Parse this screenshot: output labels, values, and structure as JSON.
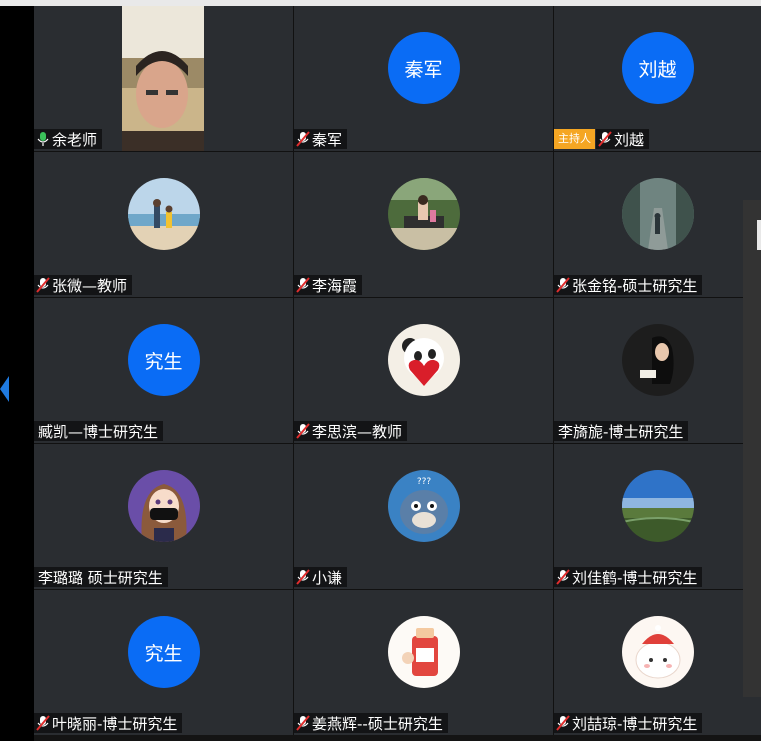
{
  "colors": {
    "accent_blue": "#0a6cf5",
    "host_badge": "#f5a623",
    "tile_bg": "#2a2d31",
    "mic_active": "#3ac15a",
    "mic_muted": "#e02d2d"
  },
  "participants": [
    {
      "name": "余老师",
      "mic": "active",
      "avatar_type": "video",
      "avatar_text": ""
    },
    {
      "name": "秦军",
      "mic": "muted",
      "avatar_type": "text",
      "avatar_text": "秦军"
    },
    {
      "name": "刘越",
      "mic": "muted",
      "avatar_type": "text",
      "avatar_text": "刘越",
      "badge": "主持人"
    },
    {
      "name": "张微—教师",
      "mic": "muted",
      "avatar_type": "photo",
      "avatar_icon": "beach-photo-icon"
    },
    {
      "name": "李海霞",
      "mic": "muted",
      "avatar_type": "photo",
      "avatar_icon": "garden-photo-icon"
    },
    {
      "name": "张金铭-硕士研究生",
      "mic": "muted",
      "avatar_type": "photo",
      "avatar_icon": "forest-walk-photo-icon"
    },
    {
      "name": "臧凯—博士研究生",
      "mic": "none",
      "avatar_type": "text",
      "avatar_text": "究生"
    },
    {
      "name": "李思滨—教师",
      "mic": "muted",
      "avatar_type": "photo",
      "avatar_icon": "panda-heart-icon"
    },
    {
      "name": "李旖旎-博士研究生",
      "mic": "none",
      "avatar_type": "photo",
      "avatar_icon": "reading-woman-photo-icon"
    },
    {
      "name": "李璐璐 硕士研究生",
      "mic": "none",
      "avatar_type": "photo",
      "avatar_icon": "anime-girl-icon"
    },
    {
      "name": "小谦",
      "mic": "muted",
      "avatar_type": "photo",
      "avatar_icon": "cartoon-cat-icon"
    },
    {
      "name": "刘佳鹤-博士研究生",
      "mic": "muted",
      "avatar_type": "photo",
      "avatar_icon": "landscape-photo-icon"
    },
    {
      "name": "叶晓丽-博士研究生",
      "mic": "muted",
      "avatar_type": "text",
      "avatar_text": "究生"
    },
    {
      "name": "姜燕辉--硕士研究生",
      "mic": "muted",
      "avatar_type": "photo",
      "avatar_icon": "drink-cup-icon"
    },
    {
      "name": "刘喆琼-博士研究生",
      "mic": "muted",
      "avatar_type": "photo",
      "avatar_icon": "cute-bunny-icon"
    }
  ]
}
